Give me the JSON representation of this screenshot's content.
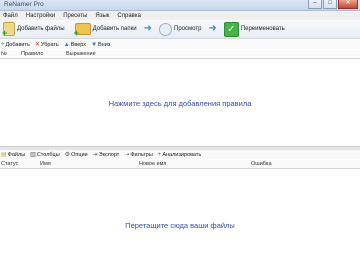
{
  "window": {
    "title": "ReNamer Pro"
  },
  "menu": [
    "Файл",
    "Настройки",
    "Пресеты",
    "Язык",
    "Справка"
  ],
  "toolbar": {
    "add_files": "Добавить файлы",
    "add_folder": "Добавить папки",
    "preview": "Просмотр",
    "rename": "Переименовать"
  },
  "rules_toolbar": [
    "Добавить",
    "Убрать",
    "Вверх",
    "Вниз"
  ],
  "rules_columns": [
    "№",
    "Правило",
    "Выражение"
  ],
  "rules_placeholder": "Нажмите здесь для добавления правила",
  "files_toolbar": [
    "Файлы",
    "Столбцы",
    "Опции",
    "Экспорт",
    "Фильтры",
    "Анализировать"
  ],
  "files_columns": [
    "Статус",
    "Имя",
    "Новое имя",
    "Ошибка"
  ],
  "files_placeholder": "Перетащите сюда ваши файлы"
}
